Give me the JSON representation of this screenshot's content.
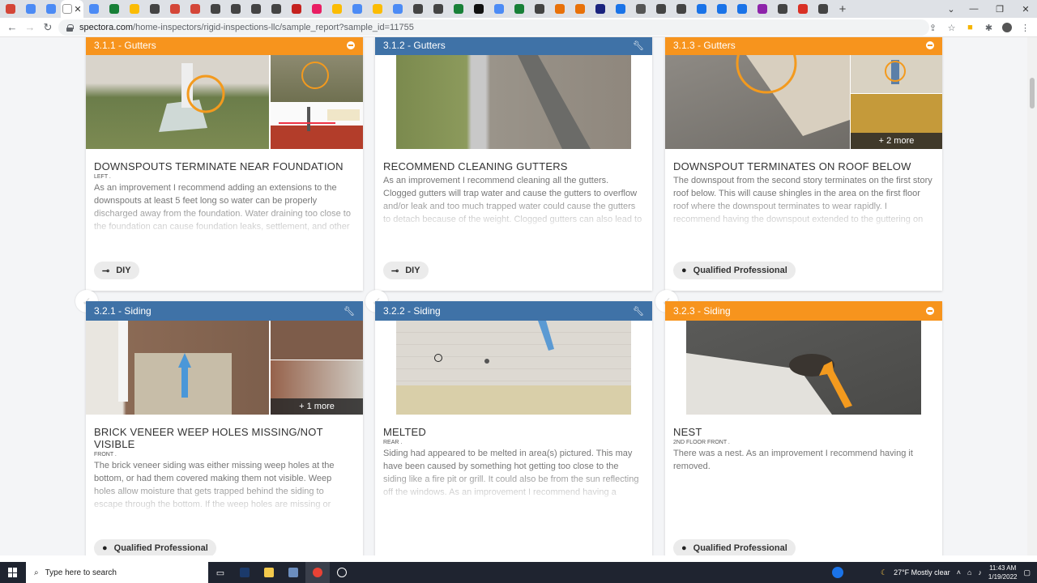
{
  "browser": {
    "tab_favicon_colors": [
      "#d44638",
      "#4c8bf5",
      "#4c8bf5",
      "#ffffff",
      "#4c8bf5",
      "#188038",
      "#fbbc04",
      "#444444",
      "#d44638",
      "#d44638",
      "#444444",
      "#444444",
      "#444444",
      "#444444",
      "#c5221f",
      "#e91e63",
      "#fbbc04",
      "#4c8bf5",
      "#fbbc04",
      "#4c8bf5",
      "#444444",
      "#444444",
      "#188038",
      "#111111",
      "#4c8bf5",
      "#188038",
      "#444444",
      "#e8710a",
      "#e8710a",
      "#1a237e",
      "#1a73e8",
      "#555555",
      "#444444",
      "#444444",
      "#1a73e8",
      "#1a73e8",
      "#1a73e8",
      "#8e24aa",
      "#444444",
      "#d93025",
      "#444444"
    ],
    "new_tab_label": "+",
    "url_host": "spectora.com",
    "url_path": "/home-inspectors/rigid-inspections-llc/sample_report?sample_id=11755",
    "window_controls": [
      "⌄",
      "—",
      "❐",
      "✕"
    ]
  },
  "cards": [
    {
      "header": "3.1.1 - Gutters",
      "color": "orange",
      "header_icon": "minus-icon",
      "title": "DOWNSPOUTS TERMINATE NEAR FOUNDATION",
      "location": "LEFT .",
      "description": "As an improvement I recommend adding an extensions to the downspouts at least 5 feet long so water can be properly discharged away from the foundation. Water draining too close to the foundation can cause foundation leaks, settlement, and other related issues.",
      "badge": "DIY",
      "badge_icon": "wrench-icon",
      "more": ""
    },
    {
      "header": "3.1.2 - Gutters",
      "color": "blue",
      "header_icon": "wrench-icon",
      "title": "RECOMMEND CLEANING GUTTERS",
      "location": "",
      "description": "As an improvement I recommend cleaning all the gutters. Clogged gutters will trap water and cause the gutters to overflow and/or leak and too much trapped water could cause the gutters to detach because of the weight. Clogged gutters can also lead to foundation issues if water is not properly dispersed.",
      "badge": "DIY",
      "badge_icon": "wrench-icon",
      "more": ""
    },
    {
      "header": "3.1.3 - Gutters",
      "color": "orange",
      "header_icon": "minus-icon",
      "title": "DOWNSPOUT TERMINATES ON ROOF BELOW",
      "location": "",
      "description": "The downspout from the second story terminates on the first story roof below. This will cause shingles in the area on the first floor roof where the downspout terminates to wear rapidly. I recommend having the downspout extended to the guttering on the first floor.",
      "badge": "Qualified Professional",
      "badge_icon": "person-icon",
      "more": "+ 2 more"
    },
    {
      "header": "3.2.1 - Siding",
      "color": "blue",
      "header_icon": "wrench-icon",
      "title": "BRICK VENEER WEEP HOLES MISSING/NOT VISIBLE",
      "location": "FRONT .",
      "description": "The brick veneer siding was either missing weep holes at the bottom, or had them covered making them not visible. Weep holes allow moisture that gets trapped behind the siding to escape through the bottom. If the weep holes are missing or blocked moisture can get trapped and can cause moisture",
      "badge": "Qualified Professional",
      "badge_icon": "person-icon",
      "more": "+ 1 more"
    },
    {
      "header": "3.2.2 - Siding",
      "color": "blue",
      "header_icon": "wrench-icon",
      "title": "MELTED",
      "location": "REAR .",
      "description": "Siding had appeared to be melted in area(s) pictured. This may have been caused by something hot getting too close to the siding like a fire pit or grill. It could also be from the sun reflecting off the windows. As an improvement I recommend having a professional evaluate and correct as needed.",
      "badge": "",
      "badge_icon": "",
      "more": ""
    },
    {
      "header": "3.2.3 - Siding",
      "color": "orange",
      "header_icon": "minus-icon",
      "title": "NEST",
      "location": "2ND FLOOR FRONT .",
      "description": "There was a nest. As an improvement I recommend having it removed.",
      "badge": "Qualified Professional",
      "badge_icon": "person-icon",
      "more": ""
    }
  ],
  "taskbar": {
    "search_placeholder": "Type here to search",
    "weather": "27°F  Mostly clear",
    "time": "11:43 AM",
    "date": "1/19/2022"
  }
}
